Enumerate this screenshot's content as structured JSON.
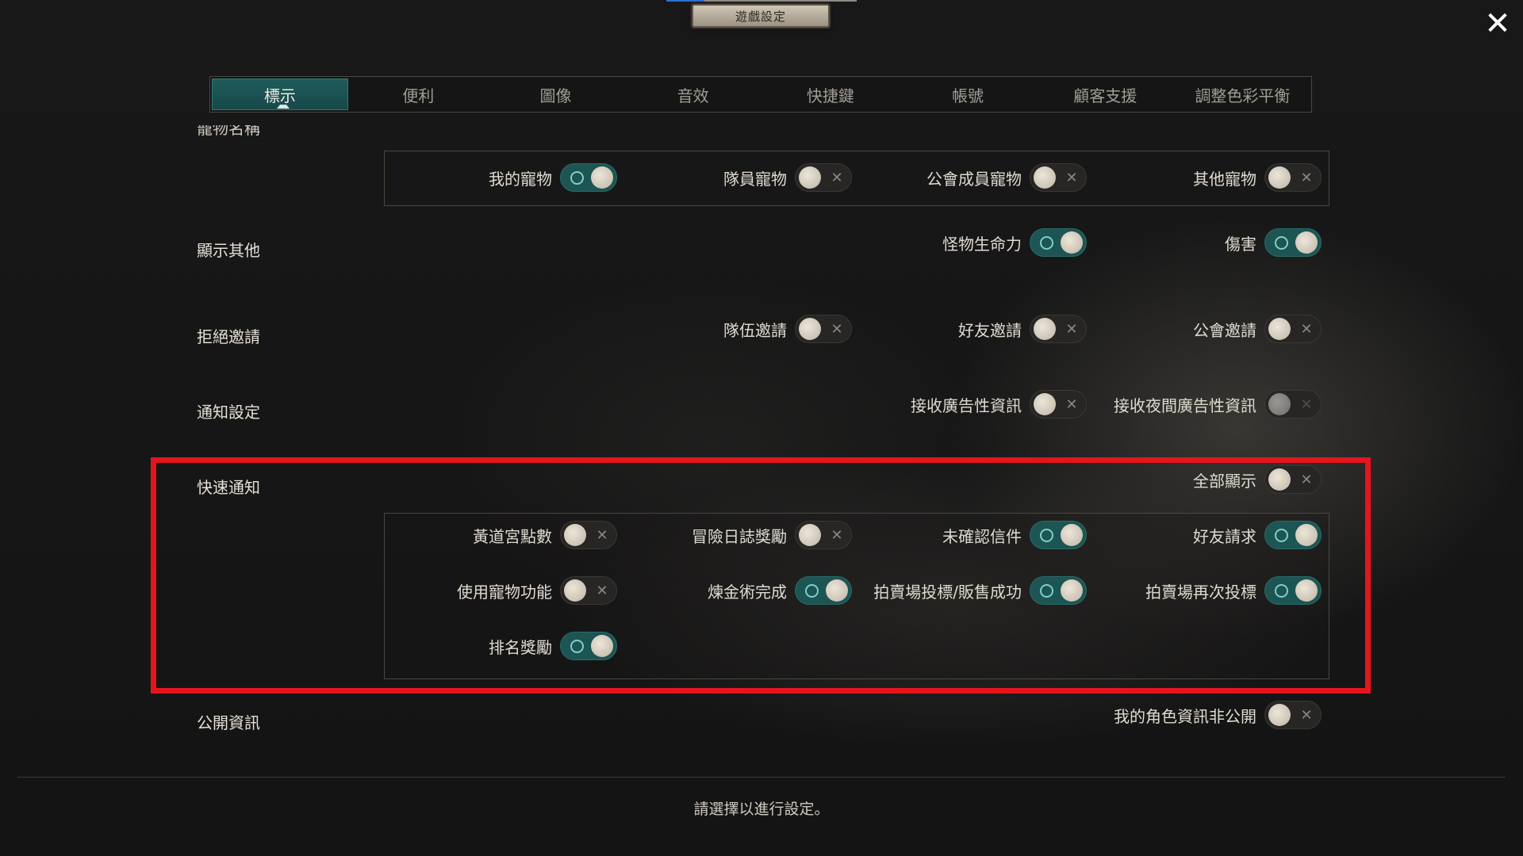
{
  "header": {
    "title": "遊戲設定"
  },
  "close_label": "✕",
  "tabs": [
    {
      "label": "標示",
      "active": true
    },
    {
      "label": "便利"
    },
    {
      "label": "圖像"
    },
    {
      "label": "音效"
    },
    {
      "label": "快捷鍵"
    },
    {
      "label": "帳號"
    },
    {
      "label": "顧客支援"
    },
    {
      "label": "調整色彩平衡"
    }
  ],
  "pet_section": {
    "label": "寵物名稱",
    "items": [
      {
        "label": "我的寵物",
        "state": "on"
      },
      {
        "label": "隊員寵物",
        "state": "off"
      },
      {
        "label": "公會成員寵物",
        "state": "off"
      },
      {
        "label": "其他寵物",
        "state": "off"
      }
    ]
  },
  "other_section": {
    "label": "顯示其他",
    "items": [
      {
        "label": "怪物生命力",
        "state": "on"
      },
      {
        "label": "傷害",
        "state": "on"
      }
    ]
  },
  "reject_section": {
    "label": "拒絕邀請",
    "items": [
      {
        "label": "隊伍邀請",
        "state": "off"
      },
      {
        "label": "好友邀請",
        "state": "off"
      },
      {
        "label": "公會邀請",
        "state": "off"
      }
    ]
  },
  "notify_section": {
    "label": "通知設定",
    "items": [
      {
        "label": "接收廣告性資訊",
        "state": "off"
      },
      {
        "label": "接收夜間廣告性資訊",
        "state": "disabled"
      }
    ]
  },
  "quick_section": {
    "label": "快速通知",
    "master": {
      "label": "全部顯示",
      "state": "off"
    },
    "items": [
      {
        "label": "黃道宮點數",
        "state": "off"
      },
      {
        "label": "冒險日誌獎勵",
        "state": "off"
      },
      {
        "label": "未確認信件",
        "state": "on"
      },
      {
        "label": "好友請求",
        "state": "on"
      },
      {
        "label": "使用寵物功能",
        "state": "off"
      },
      {
        "label": "煉金術完成",
        "state": "on"
      },
      {
        "label": "拍賣場投標/販售成功",
        "state": "on"
      },
      {
        "label": "拍賣場再次投標",
        "state": "on"
      },
      {
        "label": "排名獎勵",
        "state": "on"
      }
    ]
  },
  "public_section": {
    "label": "公開資訊",
    "items": [
      {
        "label": "我的角色資訊非公開",
        "state": "off"
      }
    ]
  },
  "footer": {
    "hint": "請選擇以進行設定。"
  },
  "colors": {
    "accent": "#1c5553",
    "highlight": "#e5141d"
  }
}
